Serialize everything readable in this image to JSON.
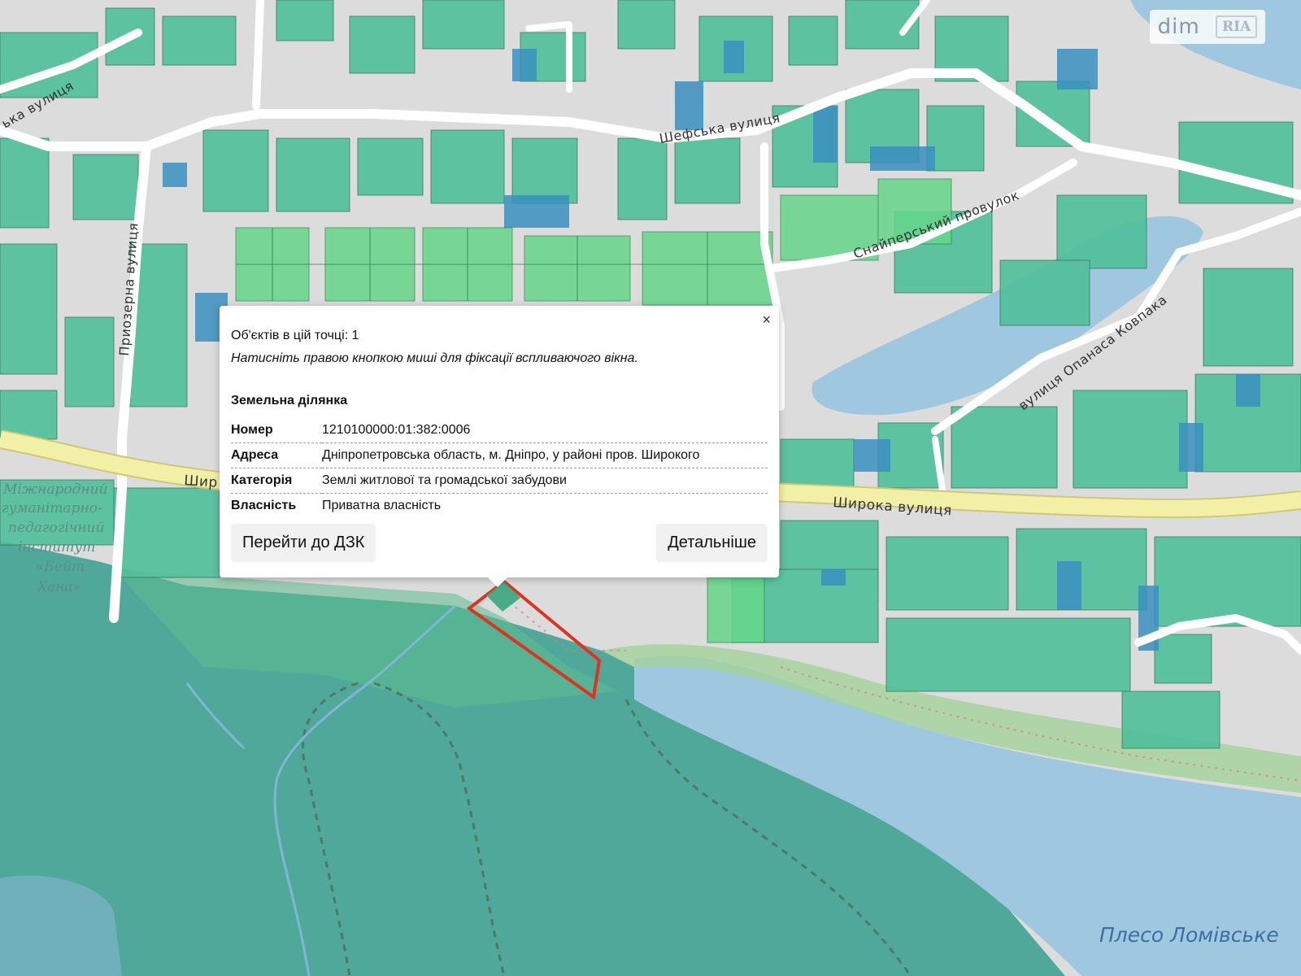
{
  "map": {
    "streets": {
      "shefska": "Шефська вулиця",
      "sniperskyi": "Снайперський провулок",
      "prozerna": "Приозерна вулиця",
      "opanasa": "вулиця Опанаса Ковпака",
      "shyroka": "Широка вулиця",
      "shyroka_partial": "Шир",
      "top_left": "ька вулиця"
    },
    "poi": {
      "line1": "Міжнародний",
      "line2": "гуманітарно-",
      "line3": "педагогічний",
      "line4": "інститут",
      "line5": "«Бейт",
      "line6": "Хана»"
    },
    "water": "Плесо Ломівське",
    "colors": {
      "parcel_residential": "#4fc09a",
      "parcel_agri": "#3a8fc0",
      "parcel_new": "#66d68a",
      "forest": "#4fa89a",
      "water": "#9fc7df",
      "selection": "#e0331f"
    }
  },
  "watermark": {
    "brand": "dim",
    "badge": "RIA"
  },
  "popup": {
    "close": "×",
    "objects_count": "Об'єктів в цій точці: 1",
    "hint": "Натисніть правою кнопкою миші для фіксації вспливаючого вікна.",
    "section": "Земельна ділянка",
    "rows": [
      {
        "label": "Номер",
        "value": "1210100000:01:382:0006"
      },
      {
        "label": "Адреса",
        "value": "Дніпропетровська область, м. Дніпро, у районі пров. Широкого"
      },
      {
        "label": "Категорія",
        "value": "Землі житлової та громадської забудови"
      },
      {
        "label": "Власність",
        "value": "Приватна власність"
      }
    ],
    "btn_dzk": "Перейти до ДЗК",
    "btn_more": "Детальніше"
  }
}
